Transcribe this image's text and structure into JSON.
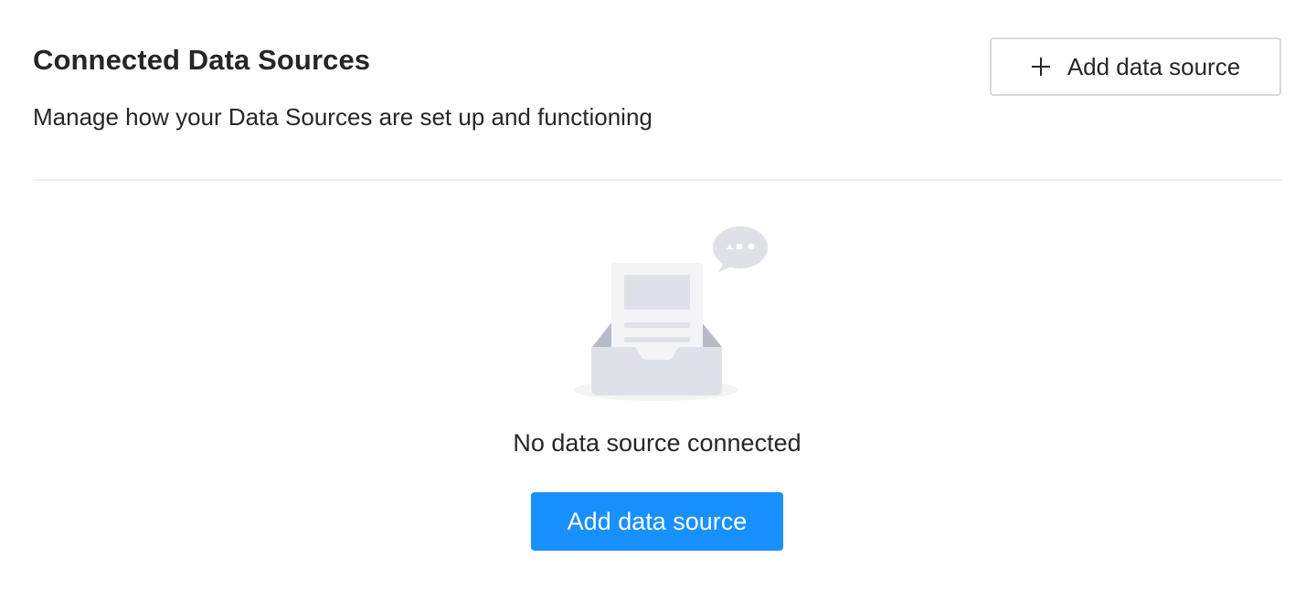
{
  "header": {
    "title": "Connected Data Sources",
    "subtitle": "Manage how your Data Sources are set up and functioning",
    "add_button_label": "Add data source",
    "add_button_icon": "plus-icon"
  },
  "empty_state": {
    "illustration": "empty-inbox-illustration",
    "message": "No data source connected",
    "primary_button_label": "Add data source"
  },
  "colors": {
    "primary": "#1890ff",
    "border": "#d9d9d9",
    "divider": "#efefef",
    "text": "#262626"
  }
}
